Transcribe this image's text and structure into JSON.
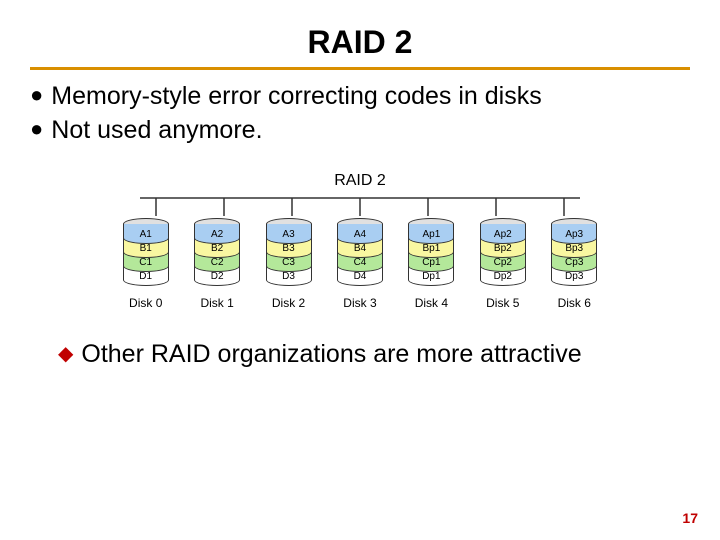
{
  "title": "RAID 2",
  "bullets": [
    "Memory-style error correcting codes in disks",
    "Not used anymore."
  ],
  "sub_bullet": "Other RAID organizations are more attractive",
  "page_number": "17",
  "diagram": {
    "title": "RAID 2",
    "disks": [
      {
        "label": "Disk 0",
        "cells": [
          "A1",
          "B1",
          "C1",
          "D1"
        ]
      },
      {
        "label": "Disk 1",
        "cells": [
          "A2",
          "B2",
          "C2",
          "D2"
        ]
      },
      {
        "label": "Disk 2",
        "cells": [
          "A3",
          "B3",
          "C3",
          "D3"
        ]
      },
      {
        "label": "Disk 3",
        "cells": [
          "A4",
          "B4",
          "C4",
          "D4"
        ]
      },
      {
        "label": "Disk 4",
        "cells": [
          "Ap1",
          "Bp1",
          "Cp1",
          "Dp1"
        ]
      },
      {
        "label": "Disk 5",
        "cells": [
          "Ap2",
          "Bp2",
          "Cp2",
          "Dp2"
        ]
      },
      {
        "label": "Disk 6",
        "cells": [
          "Ap3",
          "Bp3",
          "Cp3",
          "Dp3"
        ]
      }
    ],
    "row_colors": [
      "c-blue",
      "c-yellow",
      "c-green",
      "c-white"
    ]
  }
}
